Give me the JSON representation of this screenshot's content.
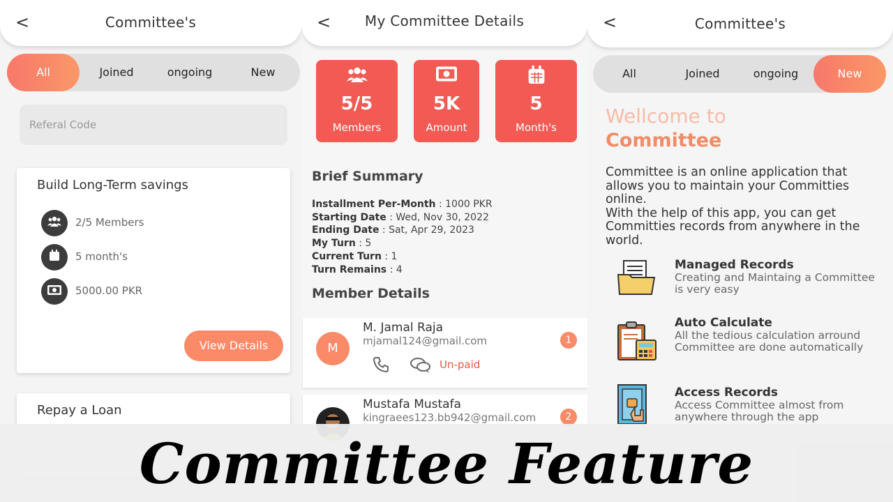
{
  "panel_left": {
    "header": {
      "back": "<",
      "title": "Committee's"
    },
    "tabs": [
      "All",
      "Joined",
      "ongoing",
      "New"
    ],
    "referral": {
      "placeholder": "Referal Code"
    },
    "card1": {
      "title": "Build Long-Term savings",
      "rows": [
        {
          "icon": "members-icon",
          "text": "2/5 Members"
        },
        {
          "icon": "calendar-icon",
          "text": "5 month's"
        },
        {
          "icon": "cash-icon",
          "text": "5000.00 PKR"
        }
      ],
      "button": "View Details"
    },
    "card2": {
      "title": "Repay a Loan"
    }
  },
  "panel_middle": {
    "header": {
      "back": "<",
      "title": "My Committee Details"
    },
    "stats": [
      {
        "icon": "members-icon",
        "value": "5/5",
        "label": "Members"
      },
      {
        "icon": "cash-icon",
        "value": "5K",
        "label": "Amount"
      },
      {
        "icon": "calendar-icon",
        "value": "5",
        "label": "Month's"
      }
    ],
    "summary_title": "Brief  Summary",
    "summary": [
      {
        "label": "Installment Per-Month",
        "value": " : 1000 PKR"
      },
      {
        "label": "Starting Date",
        "value": " : Wed, Nov 30, 2022"
      },
      {
        "label": "Ending Date",
        "value": " : Sat, Apr 29, 2023"
      },
      {
        "label": "My Turn",
        "value": " : 5"
      },
      {
        "label": "Current Turn",
        "value": " : 1"
      },
      {
        "label": "Turn Remains",
        "value": " : 4"
      }
    ],
    "members_title": "Member Details",
    "members": [
      {
        "avatar": "M",
        "name": "M. Jamal Raja",
        "email": "mjamal124@gmail.com",
        "turn": "1",
        "status": "Un-paid"
      },
      {
        "avatar": "",
        "name": "Mustafa Mustafa",
        "email": "kingraees123.bb942@gmail.com",
        "turn": "2"
      }
    ]
  },
  "panel_right": {
    "header": {
      "back": "<",
      "title": "Committee's"
    },
    "tabs": [
      "All",
      "Joined",
      "ongoing",
      "New"
    ],
    "welcome_line1": "Wellcome to",
    "welcome_line2": "Committee",
    "description": "Committee is an online application that allows you to maintain your Committies online.\nWith the help of this app, you can get Committies records from anywhere in the world.",
    "features": [
      {
        "icon": "folder-document-icon",
        "title": "Managed Records",
        "text": "Creating and Maintaing a Committee is very easy"
      },
      {
        "icon": "clipboard-calculator-icon",
        "title": "Auto Calculate",
        "text": "All the tedious calculation arround Committee are done automatically"
      },
      {
        "icon": "door-hand-icon",
        "title": "Access Records",
        "text": "Access Committee almost from anywhere through the app"
      }
    ]
  },
  "banner": {
    "text": "Committee Feature"
  },
  "colors": {
    "accent": "#fa8a68",
    "stat_red": "#f25a54",
    "welcome_light": "#f6bca8",
    "welcome_bold": "#f08c68"
  }
}
